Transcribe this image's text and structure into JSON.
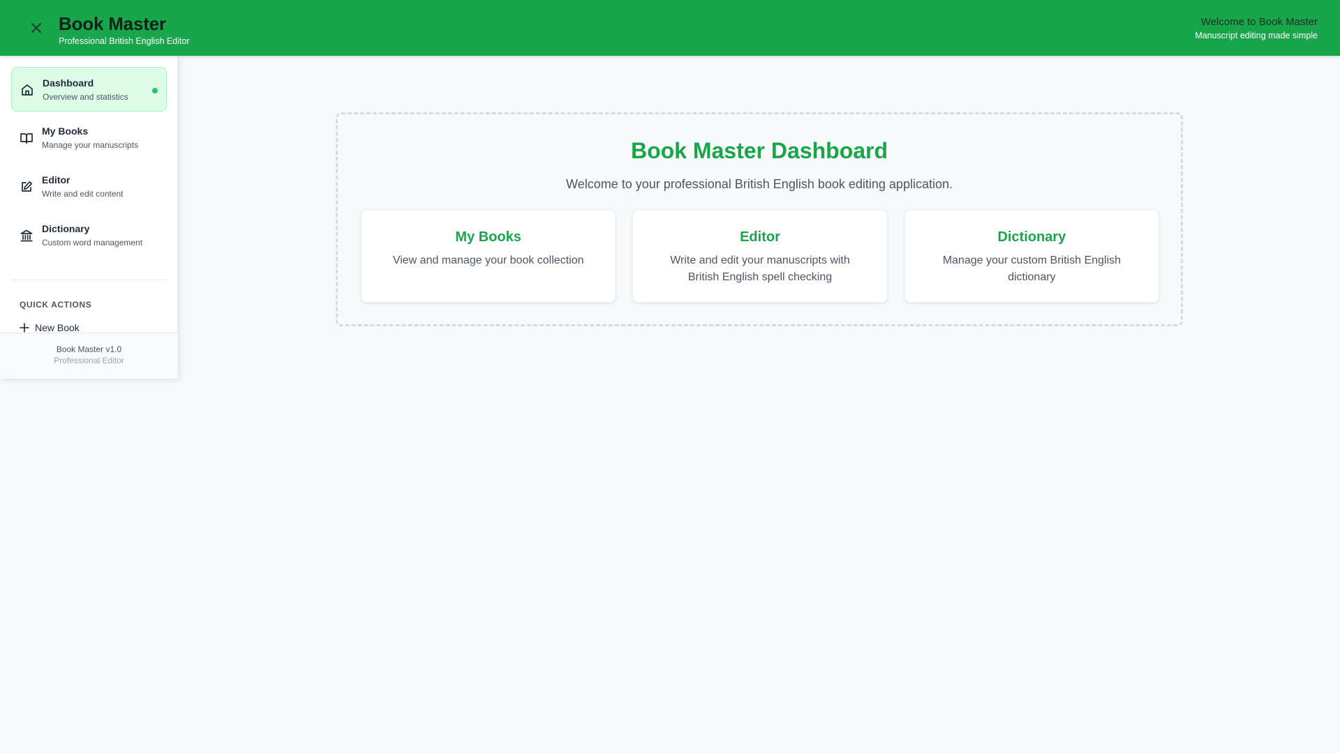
{
  "header": {
    "title": "Book Master",
    "subtitle": "Professional British English Editor",
    "right_title": "Welcome to Book Master",
    "right_subtitle": "Manuscript editing made simple",
    "close_icon": "close-icon"
  },
  "sidebar": {
    "items": [
      {
        "label": "Dashboard",
        "description": "Overview and statistics",
        "icon": "home-icon",
        "active": true
      },
      {
        "label": "My Books",
        "description": "Manage your manuscripts",
        "icon": "open-book-icon",
        "active": false
      },
      {
        "label": "Editor",
        "description": "Write and edit content",
        "icon": "edit-icon",
        "active": false
      },
      {
        "label": "Dictionary",
        "description": "Custom word management",
        "icon": "library-icon",
        "active": false
      }
    ],
    "quick_actions": {
      "heading": "QUICK ACTIONS",
      "items": [
        {
          "label": "New Book",
          "icon": "plus-icon"
        }
      ]
    },
    "footer": {
      "version": "Book Master v1.0",
      "subtitle": "Professional Editor"
    }
  },
  "main": {
    "title": "Book Master Dashboard",
    "subtitle": "Welcome to your professional British English book editing application.",
    "cards": [
      {
        "title": "My Books",
        "description": "View and manage your book collection"
      },
      {
        "title": "Editor",
        "description": "Write and edit your manuscripts with British English spell checking"
      },
      {
        "title": "Dictionary",
        "description": "Manage your custom British English dictionary"
      }
    ]
  },
  "colors": {
    "brand": "#19a64a",
    "active_bg": "#dcfce7",
    "dot": "#22c55e",
    "background": "#f8f9fa"
  }
}
